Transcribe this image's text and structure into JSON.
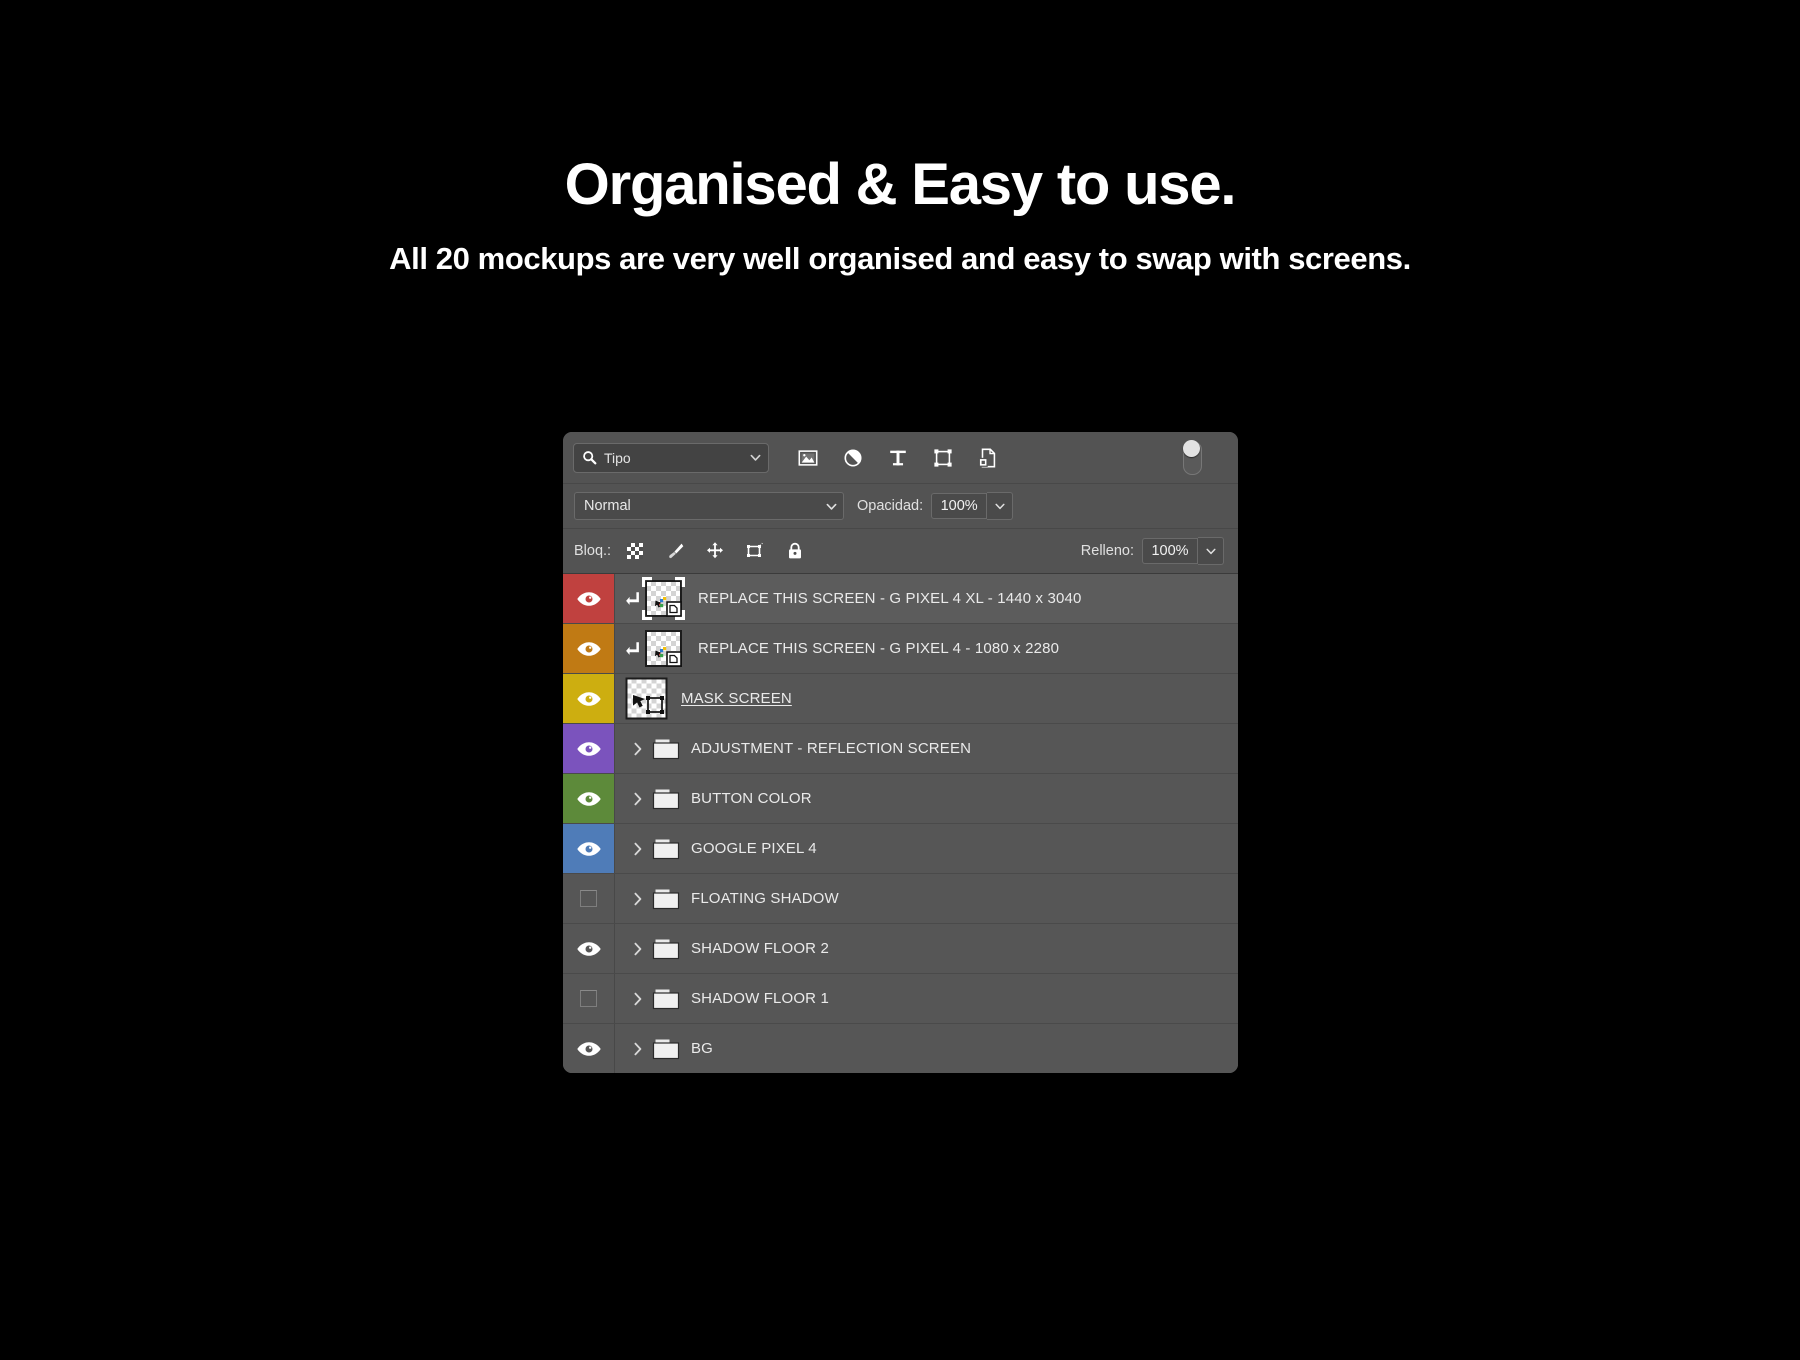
{
  "hero": {
    "title": "Organised & Easy to use.",
    "subtitle": "All 20 mockups are very well organised and easy to swap with screens."
  },
  "panel": {
    "filter_bar": {
      "search_value": "Tipo",
      "search_icon": "search-icon",
      "dropdown_icon": "chevron-down-icon",
      "filter_icons": [
        {
          "name": "pixel-layer-filter-icon",
          "title": "Pixel layers"
        },
        {
          "name": "adjustment-layer-filter-icon",
          "title": "Adjustment layers"
        },
        {
          "name": "type-layer-filter-icon",
          "title": "Type layers"
        },
        {
          "name": "shape-layer-filter-icon",
          "title": "Shape layers"
        },
        {
          "name": "smart-object-filter-icon",
          "title": "Smart objects"
        }
      ],
      "toggle_name": "filter-enable-toggle"
    },
    "blend_bar": {
      "blend_mode": "Normal",
      "opacity_label": "Opacidad:",
      "opacity_value": "100%"
    },
    "lock_bar": {
      "lock_label": "Bloq.:",
      "lock_icons": [
        {
          "name": "lock-transparent-pixels-icon"
        },
        {
          "name": "lock-image-pixels-icon"
        },
        {
          "name": "lock-position-icon"
        },
        {
          "name": "lock-artboard-nesting-icon"
        },
        {
          "name": "lock-all-icon"
        }
      ],
      "fill_label": "Relleno:",
      "fill_value": "100%"
    },
    "layers": [
      {
        "name": "REPLACE THIS SCREEN - G PIXEL 4 XL - 1440 x 3040",
        "color": "#c0413f",
        "visible": true,
        "selected": true,
        "kind": "smart-object",
        "clipped": true,
        "underlined": false
      },
      {
        "name": "REPLACE THIS SCREEN - G PIXEL 4 - 1080 x 2280",
        "color": "#c07a14",
        "visible": true,
        "selected": false,
        "kind": "smart-object",
        "clipped": true,
        "underlined": false
      },
      {
        "name": "MASK SCREEN",
        "color": "#cdae10",
        "visible": true,
        "selected": false,
        "kind": "shape",
        "clipped": false,
        "underlined": true
      },
      {
        "name": "ADJUSTMENT - REFLECTION SCREEN",
        "color": "#7b53bd",
        "visible": true,
        "selected": false,
        "kind": "group",
        "clipped": false,
        "underlined": false
      },
      {
        "name": "BUTTON COLOR",
        "color": "#5d8a3a",
        "visible": true,
        "selected": false,
        "kind": "group",
        "clipped": false,
        "underlined": false
      },
      {
        "name": "GOOGLE PIXEL 4",
        "color": "#4f7cb8",
        "visible": true,
        "selected": false,
        "kind": "group",
        "clipped": false,
        "underlined": false
      },
      {
        "name": "FLOATING SHADOW",
        "color": "none",
        "visible": false,
        "selected": false,
        "kind": "group",
        "clipped": false,
        "underlined": false
      },
      {
        "name": "SHADOW FLOOR 2",
        "color": "none",
        "visible": true,
        "selected": false,
        "kind": "group",
        "clipped": false,
        "underlined": false
      },
      {
        "name": "SHADOW FLOOR 1",
        "color": "none",
        "visible": false,
        "selected": false,
        "kind": "group",
        "clipped": false,
        "underlined": false
      },
      {
        "name": "BG",
        "color": "none",
        "visible": true,
        "selected": false,
        "kind": "group",
        "clipped": false,
        "underlined": false
      }
    ]
  },
  "colors": {
    "background": "#000000",
    "panel_bg": "#535353",
    "row_bg": "#565656",
    "row_selected_bg": "#5c5c5c",
    "text": "#eaeaea"
  }
}
